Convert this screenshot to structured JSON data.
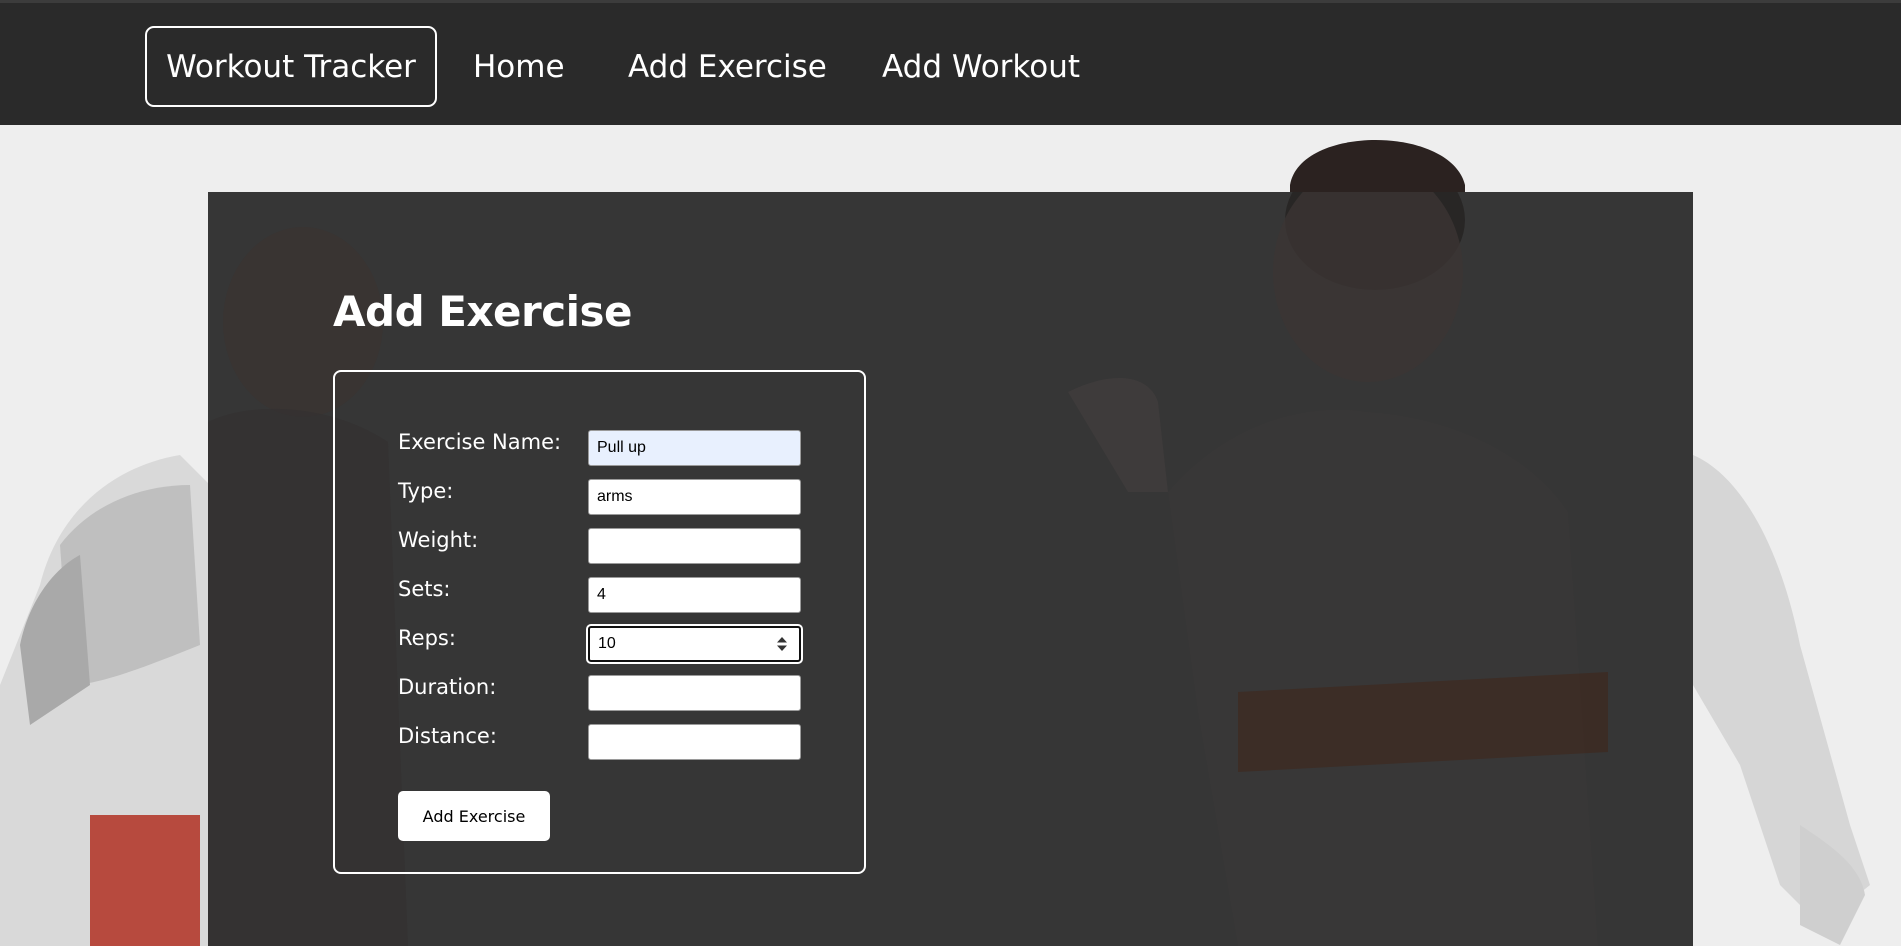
{
  "nav": {
    "brand": "Workout Tracker",
    "links": [
      "Home",
      "Add Exercise",
      "Add Workout"
    ]
  },
  "page": {
    "title": "Add Exercise"
  },
  "form": {
    "fields": [
      {
        "label": "Exercise Name:",
        "value": "Pull up"
      },
      {
        "label": "Type:",
        "value": "arms"
      },
      {
        "label": "Weight:",
        "value": ""
      },
      {
        "label": "Sets:",
        "value": "4"
      },
      {
        "label": "Reps:",
        "value": "10"
      },
      {
        "label": "Duration:",
        "value": ""
      },
      {
        "label": "Distance:",
        "value": ""
      }
    ],
    "submit_label": "Add Exercise"
  },
  "icons": {
    "spinner": "number-spinner-icon"
  },
  "colors": {
    "navbar": "#2a2a2a",
    "panel": "#1c1c1c",
    "page_background": "#eeeeee",
    "autofill": "#e8f0fe"
  }
}
